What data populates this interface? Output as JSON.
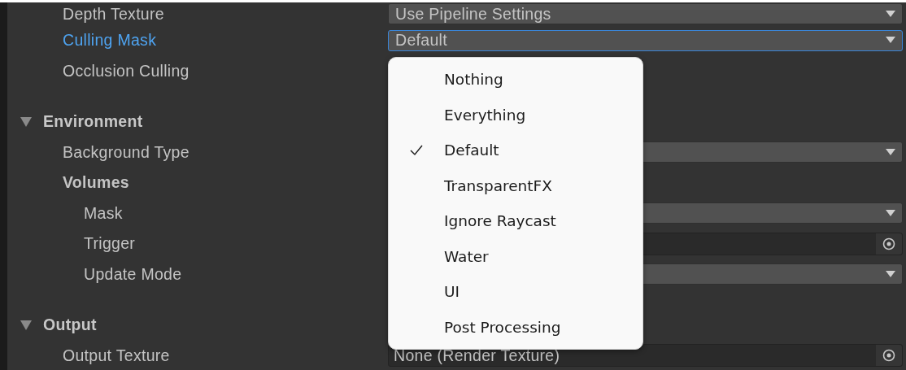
{
  "top_properties": [
    {
      "label": "Depth Texture",
      "field": {
        "kind": "dropdown",
        "value": "Use Pipeline Settings",
        "focused": false
      }
    },
    {
      "label": "Culling Mask",
      "field": {
        "kind": "dropdown",
        "value": "Default",
        "focused": true,
        "menu": [
          {
            "label": "Nothing",
            "selected": false
          },
          {
            "label": "Everything",
            "selected": false
          },
          {
            "label": "Default",
            "selected": true
          },
          {
            "label": "TransparentFX",
            "selected": false
          },
          {
            "label": "Ignore Raycast",
            "selected": false
          },
          {
            "label": "Water",
            "selected": false
          },
          {
            "label": "UI",
            "selected": false
          },
          {
            "label": "Post Processing",
            "selected": false
          }
        ]
      }
    },
    {
      "label": "Occlusion Culling"
    }
  ],
  "sections": [
    {
      "title": "Environment",
      "expanded": true,
      "properties": [
        {
          "label": "Background Type",
          "field": {
            "kind": "dropdown",
            "focused": false
          }
        },
        {
          "label": "Volumes",
          "children": [
            {
              "label": "Mask",
              "field": {
                "kind": "dropdown",
                "focused": false
              }
            },
            {
              "label": "Trigger",
              "field": {
                "kind": "object",
                "focused": false
              }
            },
            {
              "label": "Update Mode",
              "field": {
                "kind": "dropdown",
                "focused": false
              }
            }
          ]
        }
      ]
    },
    {
      "title": "Output",
      "expanded": true,
      "properties": [
        {
          "label": "Output Texture",
          "field": {
            "kind": "object",
            "value": "None (Render Texture)",
            "focused": false
          }
        }
      ]
    }
  ]
}
